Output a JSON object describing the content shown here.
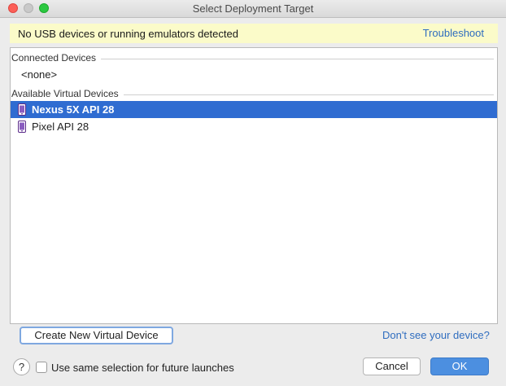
{
  "window": {
    "title": "Select Deployment Target"
  },
  "notice": {
    "message": "No USB devices or running emulators detected",
    "link": "Troubleshoot"
  },
  "sections": {
    "connected": {
      "label": "Connected Devices",
      "empty_label": "<none>"
    },
    "available": {
      "label": "Available Virtual Devices",
      "devices": [
        {
          "name": "Nexus 5X API 28",
          "icon": "phone-icon",
          "selected": true
        },
        {
          "name": "Pixel API 28",
          "icon": "phone-icon",
          "selected": false
        }
      ]
    }
  },
  "footer": {
    "create_button": "Create New Virtual Device",
    "help_link": "Don't see your device?",
    "help_icon": "?",
    "checkbox_label": "Use same selection for future launches",
    "checkbox_checked": false,
    "cancel_button": "Cancel",
    "ok_button": "OK"
  },
  "colors": {
    "selection": "#2f6cd1",
    "link": "#2f6dbf",
    "notice_bg": "#fbfbc9",
    "ok_button": "#4c8fe0"
  }
}
